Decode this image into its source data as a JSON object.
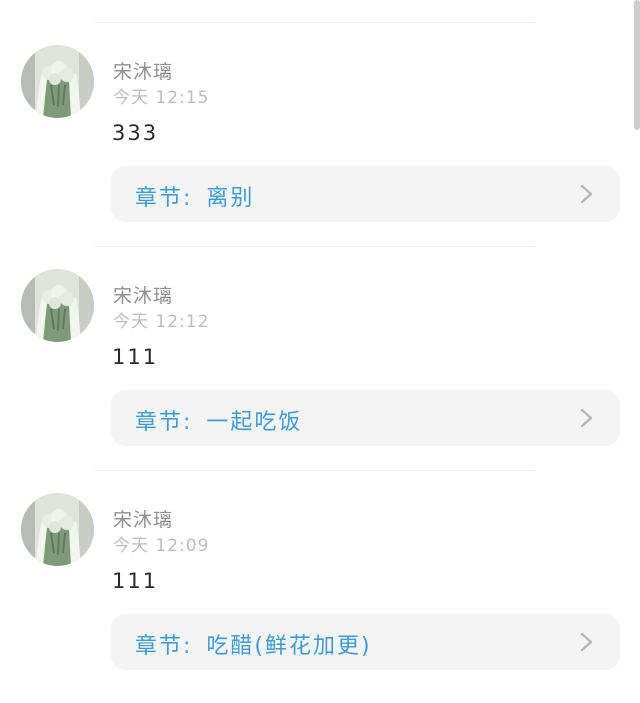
{
  "comments": [
    {
      "username": "宋沐璃",
      "time": "今天 12:15",
      "content": "333",
      "chapter_prefix": "章节:",
      "chapter_title": "离别"
    },
    {
      "username": "宋沐璃",
      "time": "今天 12:12",
      "content": "111",
      "chapter_prefix": "章节:",
      "chapter_title": "一起吃饭"
    },
    {
      "username": "宋沐璃",
      "time": "今天 12:09",
      "content": "111",
      "chapter_prefix": "章节:",
      "chapter_title": "吃醋(鲜花加更)"
    }
  ],
  "colors": {
    "chapter_text": "#3e9bd6",
    "card_background": "#f4f4f4",
    "username": "#8f8f8f",
    "time": "#bdbdbd"
  }
}
